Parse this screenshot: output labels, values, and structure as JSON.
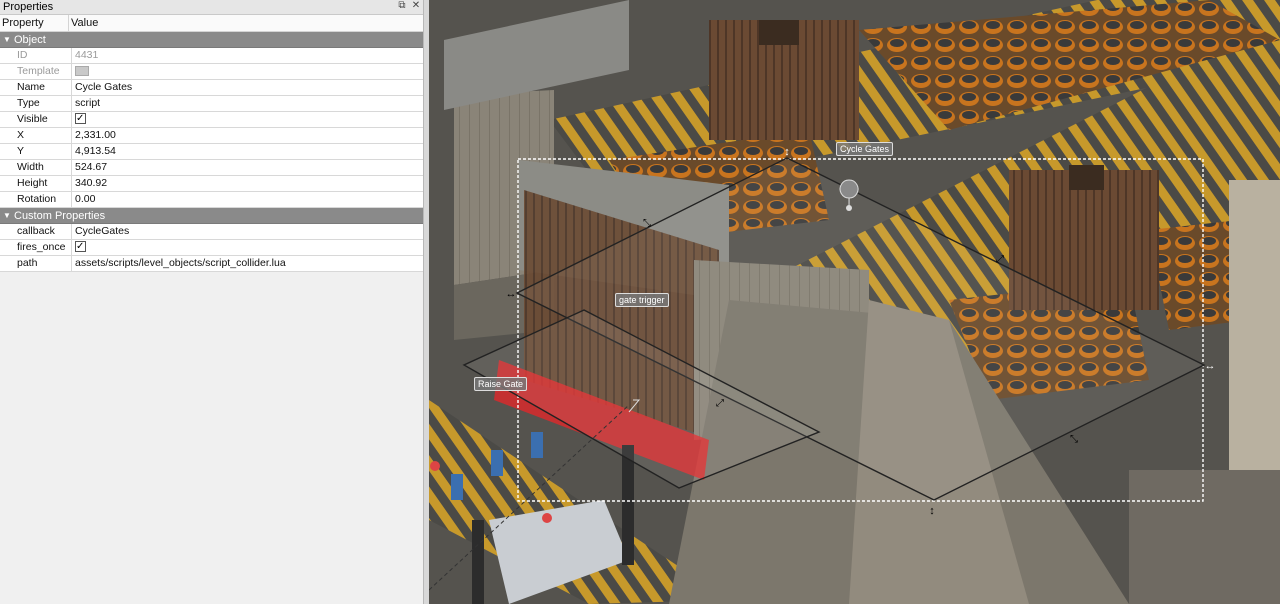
{
  "dock": {
    "title": "Properties",
    "float_icon": "float-icon",
    "close_icon": "close-icon",
    "header": {
      "property": "Property",
      "value": "Value"
    }
  },
  "groups": {
    "object": {
      "label": "Object",
      "id": {
        "key": "ID",
        "value": "4431"
      },
      "template": {
        "key": "Template"
      },
      "name": {
        "key": "Name",
        "value": "Cycle Gates"
      },
      "type": {
        "key": "Type",
        "value": "script"
      },
      "visible": {
        "key": "Visible",
        "checked": true
      },
      "x": {
        "key": "X",
        "value": "2,331.00"
      },
      "y": {
        "key": "Y",
        "value": "4,913.54"
      },
      "width": {
        "key": "Width",
        "value": "524.67"
      },
      "height": {
        "key": "Height",
        "value": "340.92"
      },
      "rotation": {
        "key": "Rotation",
        "value": "0.00"
      }
    },
    "custom": {
      "label": "Custom Properties",
      "callback": {
        "key": "callback",
        "value": "CycleGates"
      },
      "fires_once": {
        "key": "fires_once",
        "checked": true
      },
      "path": {
        "key": "path",
        "value": "assets/scripts/level_objects/script_collider.lua"
      }
    }
  },
  "map_labels": {
    "cycle_gates": "Cycle Gates",
    "gate_trigger": "gate trigger",
    "raise_gate": "Raise Gate"
  },
  "colors": {
    "group_bg": "#8a8a8a",
    "hazard_stripe": "#c7992b",
    "barrel": "#c8741e",
    "selection": "#ffffff",
    "red_gate": "#e0282a"
  }
}
